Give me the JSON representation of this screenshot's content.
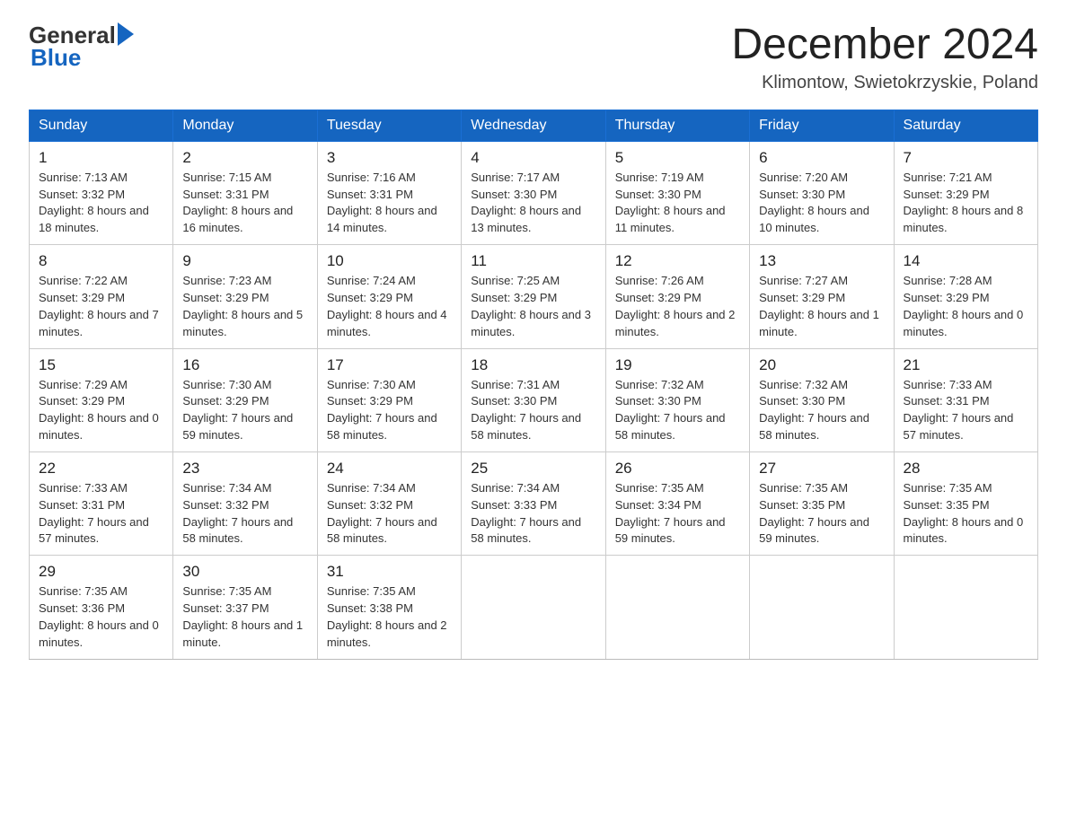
{
  "header": {
    "logo_general": "General",
    "logo_blue": "Blue",
    "title": "December 2024",
    "subtitle": "Klimontow, Swietokrzyskie, Poland"
  },
  "days_of_week": [
    "Sunday",
    "Monday",
    "Tuesday",
    "Wednesday",
    "Thursday",
    "Friday",
    "Saturday"
  ],
  "weeks": [
    [
      {
        "day": "1",
        "sunrise": "7:13 AM",
        "sunset": "3:32 PM",
        "daylight": "8 hours and 18 minutes."
      },
      {
        "day": "2",
        "sunrise": "7:15 AM",
        "sunset": "3:31 PM",
        "daylight": "8 hours and 16 minutes."
      },
      {
        "day": "3",
        "sunrise": "7:16 AM",
        "sunset": "3:31 PM",
        "daylight": "8 hours and 14 minutes."
      },
      {
        "day": "4",
        "sunrise": "7:17 AM",
        "sunset": "3:30 PM",
        "daylight": "8 hours and 13 minutes."
      },
      {
        "day": "5",
        "sunrise": "7:19 AM",
        "sunset": "3:30 PM",
        "daylight": "8 hours and 11 minutes."
      },
      {
        "day": "6",
        "sunrise": "7:20 AM",
        "sunset": "3:30 PM",
        "daylight": "8 hours and 10 minutes."
      },
      {
        "day": "7",
        "sunrise": "7:21 AM",
        "sunset": "3:29 PM",
        "daylight": "8 hours and 8 minutes."
      }
    ],
    [
      {
        "day": "8",
        "sunrise": "7:22 AM",
        "sunset": "3:29 PM",
        "daylight": "8 hours and 7 minutes."
      },
      {
        "day": "9",
        "sunrise": "7:23 AM",
        "sunset": "3:29 PM",
        "daylight": "8 hours and 5 minutes."
      },
      {
        "day": "10",
        "sunrise": "7:24 AM",
        "sunset": "3:29 PM",
        "daylight": "8 hours and 4 minutes."
      },
      {
        "day": "11",
        "sunrise": "7:25 AM",
        "sunset": "3:29 PM",
        "daylight": "8 hours and 3 minutes."
      },
      {
        "day": "12",
        "sunrise": "7:26 AM",
        "sunset": "3:29 PM",
        "daylight": "8 hours and 2 minutes."
      },
      {
        "day": "13",
        "sunrise": "7:27 AM",
        "sunset": "3:29 PM",
        "daylight": "8 hours and 1 minute."
      },
      {
        "day": "14",
        "sunrise": "7:28 AM",
        "sunset": "3:29 PM",
        "daylight": "8 hours and 0 minutes."
      }
    ],
    [
      {
        "day": "15",
        "sunrise": "7:29 AM",
        "sunset": "3:29 PM",
        "daylight": "8 hours and 0 minutes."
      },
      {
        "day": "16",
        "sunrise": "7:30 AM",
        "sunset": "3:29 PM",
        "daylight": "7 hours and 59 minutes."
      },
      {
        "day": "17",
        "sunrise": "7:30 AM",
        "sunset": "3:29 PM",
        "daylight": "7 hours and 58 minutes."
      },
      {
        "day": "18",
        "sunrise": "7:31 AM",
        "sunset": "3:30 PM",
        "daylight": "7 hours and 58 minutes."
      },
      {
        "day": "19",
        "sunrise": "7:32 AM",
        "sunset": "3:30 PM",
        "daylight": "7 hours and 58 minutes."
      },
      {
        "day": "20",
        "sunrise": "7:32 AM",
        "sunset": "3:30 PM",
        "daylight": "7 hours and 58 minutes."
      },
      {
        "day": "21",
        "sunrise": "7:33 AM",
        "sunset": "3:31 PM",
        "daylight": "7 hours and 57 minutes."
      }
    ],
    [
      {
        "day": "22",
        "sunrise": "7:33 AM",
        "sunset": "3:31 PM",
        "daylight": "7 hours and 57 minutes."
      },
      {
        "day": "23",
        "sunrise": "7:34 AM",
        "sunset": "3:32 PM",
        "daylight": "7 hours and 58 minutes."
      },
      {
        "day": "24",
        "sunrise": "7:34 AM",
        "sunset": "3:32 PM",
        "daylight": "7 hours and 58 minutes."
      },
      {
        "day": "25",
        "sunrise": "7:34 AM",
        "sunset": "3:33 PM",
        "daylight": "7 hours and 58 minutes."
      },
      {
        "day": "26",
        "sunrise": "7:35 AM",
        "sunset": "3:34 PM",
        "daylight": "7 hours and 59 minutes."
      },
      {
        "day": "27",
        "sunrise": "7:35 AM",
        "sunset": "3:35 PM",
        "daylight": "7 hours and 59 minutes."
      },
      {
        "day": "28",
        "sunrise": "7:35 AM",
        "sunset": "3:35 PM",
        "daylight": "8 hours and 0 minutes."
      }
    ],
    [
      {
        "day": "29",
        "sunrise": "7:35 AM",
        "sunset": "3:36 PM",
        "daylight": "8 hours and 0 minutes."
      },
      {
        "day": "30",
        "sunrise": "7:35 AM",
        "sunset": "3:37 PM",
        "daylight": "8 hours and 1 minute."
      },
      {
        "day": "31",
        "sunrise": "7:35 AM",
        "sunset": "3:38 PM",
        "daylight": "8 hours and 2 minutes."
      },
      null,
      null,
      null,
      null
    ]
  ]
}
